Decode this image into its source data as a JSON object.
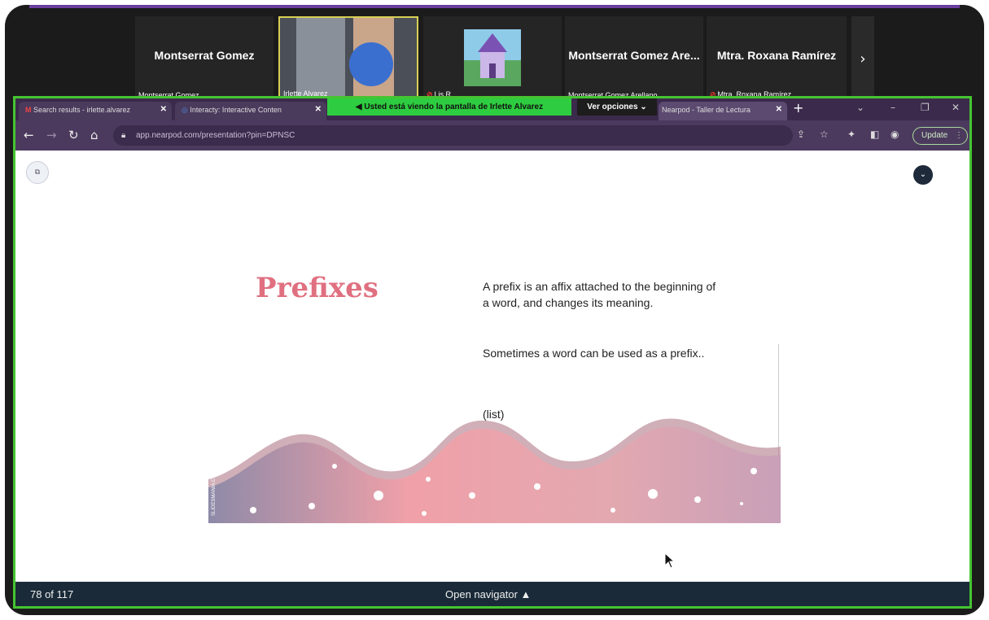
{
  "participants": [
    {
      "big": "Montserrat Gomez",
      "small": "Montserrat Gomez",
      "muted": false
    },
    {
      "big": "",
      "small": "Irlette Alvarez",
      "muted": false
    },
    {
      "big": "",
      "small": "Lis R",
      "muted": true
    },
    {
      "big": "Montserrat Gomez Are...",
      "small": "Montserrat Gomez Arellano",
      "muted": false
    },
    {
      "big": "Mtra. Roxana Ramírez",
      "small": "Mtra. Roxana Ramírez",
      "muted": true
    }
  ],
  "share": {
    "banner": "Usted está viendo la pantalla de  Irlette Alvarez",
    "options": "Ver opciones"
  },
  "browser": {
    "tabs": [
      {
        "label": "Search results - irlette.alvarez"
      },
      {
        "label": "Interacty: Interactive Conten"
      },
      {
        "label": "Nearpod - Taller de Lectura"
      }
    ],
    "url": "app.nearpod.com/presentation?pin=DPNSC",
    "update_label": "Update"
  },
  "slide": {
    "title": "Prefixes",
    "body1": "A prefix is an affix attached to the beginning of a word, and changes its meaning.",
    "body2": "Sometimes a word can be used as a prefix..",
    "body3": "(list)",
    "credit": "SLIDESMANIA.COM"
  },
  "footer": {
    "page": "78 of 117",
    "navigator": "Open navigator ▲"
  },
  "colors": {
    "share_border": "#45c431",
    "title": "#e07080",
    "wave": "#e6a0a8"
  }
}
